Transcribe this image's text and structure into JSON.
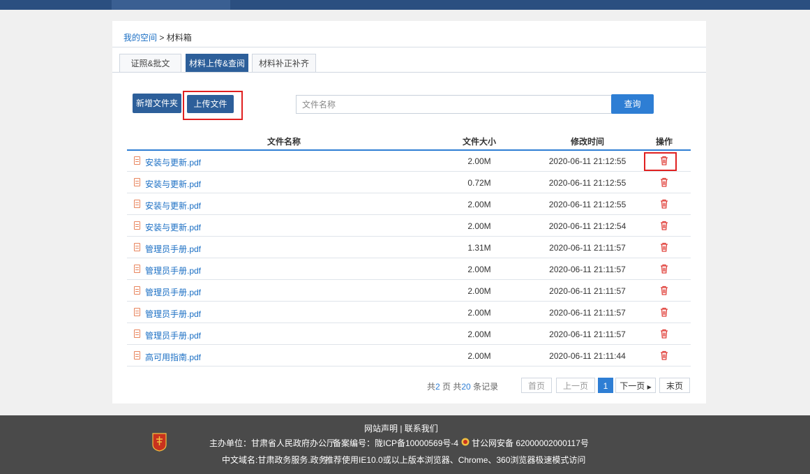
{
  "breadcrumb": {
    "home": "我的空间",
    "sep": " > ",
    "current": "材料箱"
  },
  "tabs": [
    {
      "label": "证照&批文",
      "active": false
    },
    {
      "label": "材料上传&查阅",
      "active": true
    },
    {
      "label": "材料补正补齐",
      "active": false
    }
  ],
  "toolbar": {
    "new_folder": "新增文件夹",
    "upload": "上传文件"
  },
  "search": {
    "placeholder": "文件名称",
    "button": "查询"
  },
  "table": {
    "headers": {
      "name": "文件名称",
      "size": "文件大小",
      "time": "修改时间",
      "action": "操作"
    },
    "rows": [
      {
        "name": "安装与更新.pdf",
        "size": "2.00M",
        "time": "2020-06-11 21:12:55"
      },
      {
        "name": "安装与更新.pdf",
        "size": "0.72M",
        "time": "2020-06-11 21:12:55"
      },
      {
        "name": "安装与更新.pdf",
        "size": "2.00M",
        "time": "2020-06-11 21:12:55"
      },
      {
        "name": "安装与更新.pdf",
        "size": "2.00M",
        "time": "2020-06-11 21:12:54"
      },
      {
        "name": "管理员手册.pdf",
        "size": "1.31M",
        "time": "2020-06-11 21:11:57"
      },
      {
        "name": "管理员手册.pdf",
        "size": "2.00M",
        "time": "2020-06-11 21:11:57"
      },
      {
        "name": "管理员手册.pdf",
        "size": "2.00M",
        "time": "2020-06-11 21:11:57"
      },
      {
        "name": "管理员手册.pdf",
        "size": "2.00M",
        "time": "2020-06-11 21:11:57"
      },
      {
        "name": "管理员手册.pdf",
        "size": "2.00M",
        "time": "2020-06-11 21:11:57"
      },
      {
        "name": "高可用指南.pdf",
        "size": "2.00M",
        "time": "2020-06-11 21:11:44"
      }
    ]
  },
  "pager": {
    "total_prefix": "共",
    "pages": "2",
    "pages_unit": " 页 共",
    "records": "20",
    "records_unit": " 条记录",
    "first": "首页",
    "prev": "上一页",
    "current": "1",
    "next": "下一页",
    "last": "末页"
  },
  "footer": {
    "links": "网站声明 | 联系我们",
    "host": "主办单位：甘肃省人民政府办公厅",
    "icp": "备案编号：陇ICP备10000569号-4",
    "police": "甘公网安备 62000002000117号",
    "domain": "中文域名:甘肃政务服务.政务",
    "browser": "推荐使用IE10.0或以上版本浏览器、Chrome、360浏览器极速模式访问"
  },
  "colors": {
    "primary": "#2d5f9a",
    "accent": "#2e7ed4",
    "danger": "#e02020",
    "footer": "#4a4a4a"
  }
}
